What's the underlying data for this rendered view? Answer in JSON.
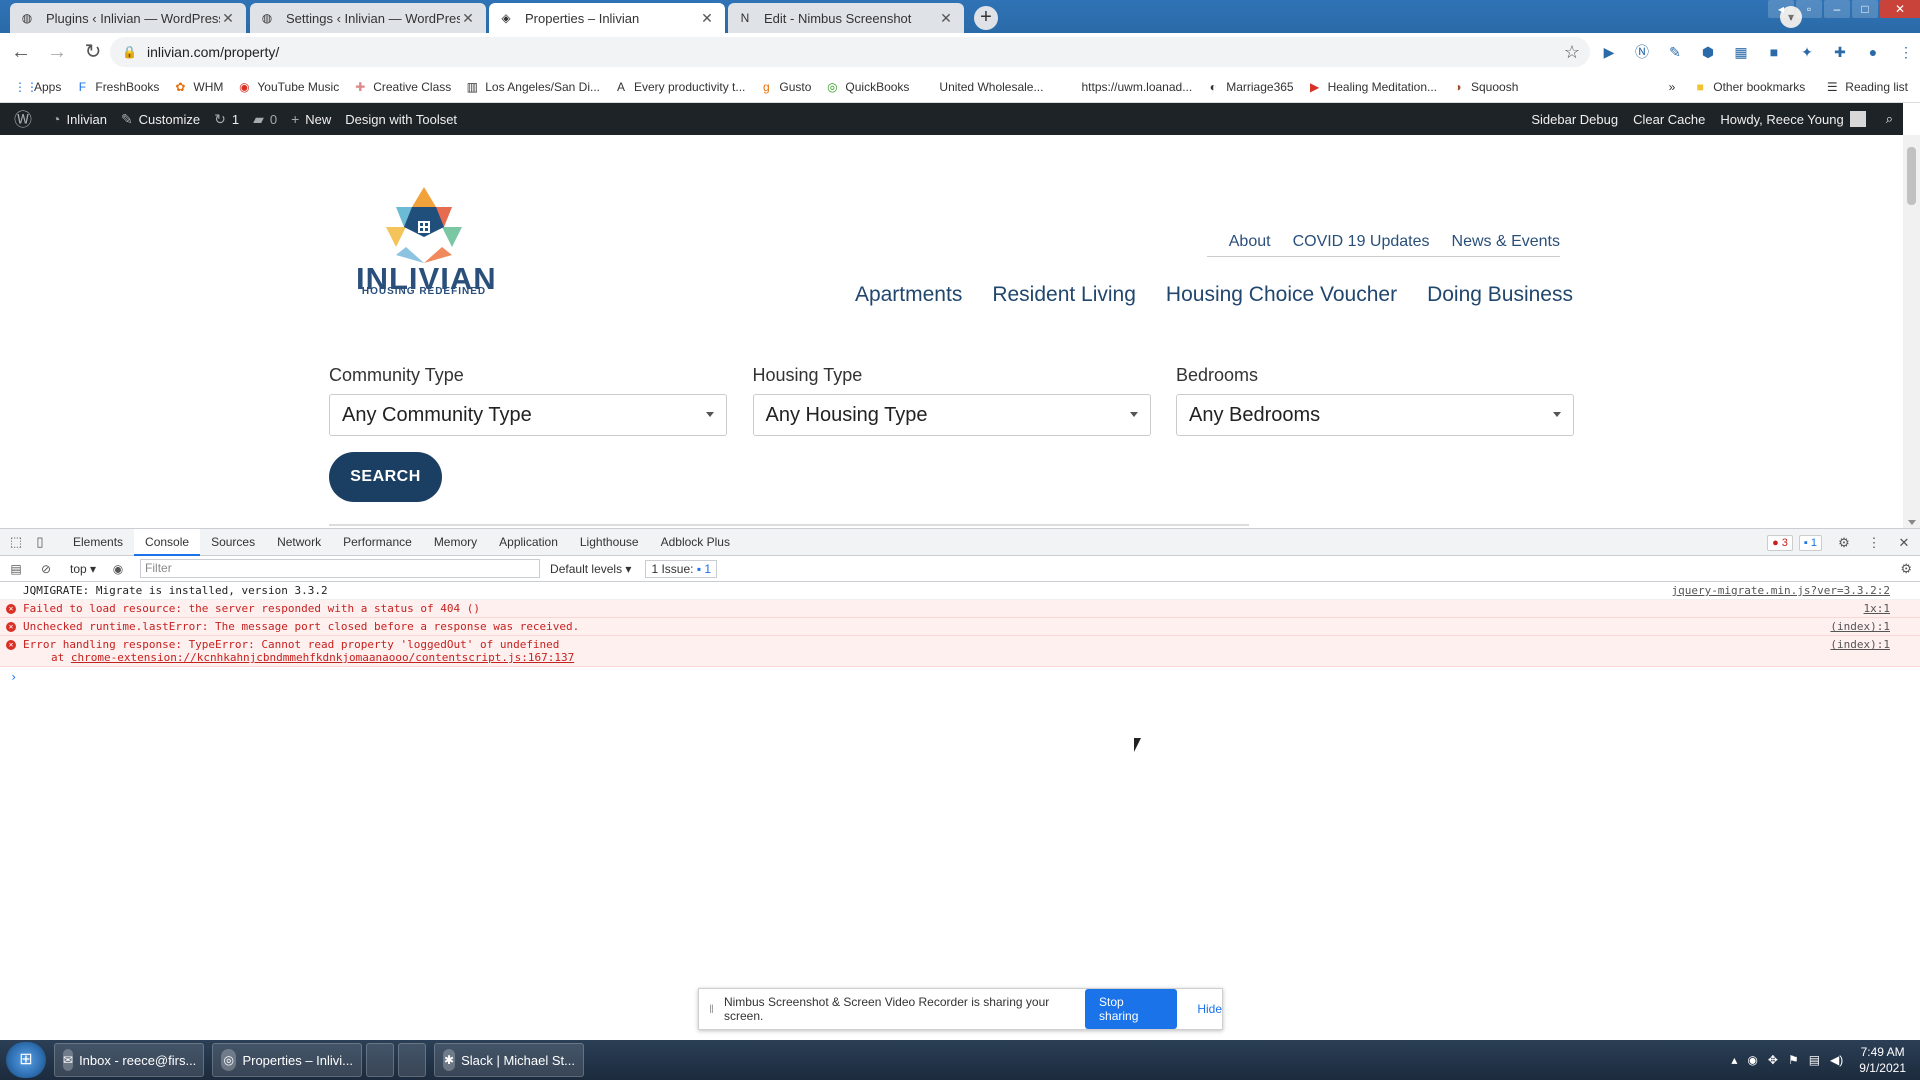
{
  "browser": {
    "tabs": [
      {
        "label": "Plugins ‹ Inlivian — WordPress",
        "icon": "wordpress-favicon"
      },
      {
        "label": "Settings ‹ Inlivian — WordPress",
        "icon": "wordpress-favicon"
      },
      {
        "label": "Properties – Inlivian",
        "icon": "inlivian-favicon",
        "active": true
      },
      {
        "label": "Edit - Nimbus Screenshot",
        "icon": "nimbus-favicon"
      }
    ],
    "url": "inlivian.com/property/",
    "bookmarks": [
      {
        "label": "Apps",
        "icon": "apps-grid-icon"
      },
      {
        "label": "FreshBooks",
        "icon": "freshbooks-icon"
      },
      {
        "label": "WHM",
        "icon": "whm-icon"
      },
      {
        "label": "YouTube Music",
        "icon": "youtube-music-icon"
      },
      {
        "label": "Creative Class",
        "icon": "creative-class-icon"
      },
      {
        "label": "Los Angeles/San Di...",
        "icon": "city-icon"
      },
      {
        "label": "Every productivity t...",
        "icon": "letter-a-icon"
      },
      {
        "label": "Gusto",
        "icon": "gusto-icon"
      },
      {
        "label": "QuickBooks",
        "icon": "quickbooks-icon"
      },
      {
        "label": "United Wholesale...",
        "icon": ""
      },
      {
        "label": "https://uwm.loanad...",
        "icon": ""
      },
      {
        "label": "Marriage365",
        "icon": "globe-icon"
      },
      {
        "label": "Healing Meditation...",
        "icon": "youtube-icon"
      },
      {
        "label": "Squoosh",
        "icon": "squoosh-icon"
      }
    ],
    "bookmarks_right": {
      "overflow": "»",
      "other": "Other bookmarks",
      "reading": "Reading list"
    }
  },
  "wp_admin_bar": {
    "site_name": "Inlivian",
    "customize": "Customize",
    "updates_count": "1",
    "comments_count": "0",
    "new": "New",
    "toolset": "Design with Toolset",
    "sidebar_debug": "Sidebar Debug",
    "clear_cache": "Clear Cache",
    "howdy": "Howdy, Reece Young"
  },
  "site": {
    "logo_word": "INLIVIAN",
    "logo_tagline": "HOUSING REDEFINED",
    "util_nav": [
      "About",
      "COVID 19 Updates",
      "News & Events"
    ],
    "main_nav": [
      "Apartments",
      "Resident Living",
      "Housing Choice Voucher",
      "Doing Business"
    ],
    "filters": [
      {
        "label": "Community Type",
        "value": "Any Community Type"
      },
      {
        "label": "Housing Type",
        "value": "Any Housing Type"
      },
      {
        "label": "Bedrooms",
        "value": "Any Bedrooms"
      }
    ],
    "search_label": "SEARCH"
  },
  "devtools": {
    "tabs": [
      "Elements",
      "Console",
      "Sources",
      "Network",
      "Performance",
      "Memory",
      "Application",
      "Lighthouse",
      "Adblock Plus"
    ],
    "active_tab": "Console",
    "error_count": "3",
    "info_count": "1",
    "context": "top",
    "filter_placeholder": "Filter",
    "levels": "Default levels",
    "issues_label": "1 Issue:",
    "issues_count": "1",
    "messages": [
      {
        "type": "log",
        "text": "JQMIGRATE: Migrate is installed, version 3.3.2",
        "source": "jquery-migrate.min.js?ver=3.3.2:2"
      },
      {
        "type": "error",
        "text": "Failed to load resource: the server responded with a status of 404 ()",
        "source": "1x:1"
      },
      {
        "type": "error",
        "text": "Unchecked runtime.lastError: The message port closed before a response was received.",
        "source": "(index):1"
      },
      {
        "type": "error",
        "text": "Error handling response: TypeError: Cannot read property 'loggedOut' of undefined",
        "stack_prefix": "at",
        "stack_link": "chrome-extension://kcnhkahnjcbndmmehfkdnkjomaanaooo/contentscript.js:167:137",
        "source": "(index):1"
      }
    ]
  },
  "share_notice": {
    "text": "Nimbus Screenshot & Screen Video Recorder is sharing your screen.",
    "stop": "Stop sharing",
    "hide": "Hide"
  },
  "taskbar": {
    "items": [
      {
        "label": "Inbox - reece@firs...",
        "icon": "outlook-icon"
      },
      {
        "label": "Properties – Inlivi...",
        "icon": "chrome-icon"
      },
      {
        "label": "Slack | Michael St...",
        "icon": "slack-icon"
      }
    ],
    "time": "7:49 AM",
    "date": "9/1/2021"
  },
  "colors": {
    "wp_bar": "#1d2327",
    "brand_navy": "#1b3f63",
    "chrome_blue": "#2f73b6",
    "error_red": "#c5221f"
  }
}
